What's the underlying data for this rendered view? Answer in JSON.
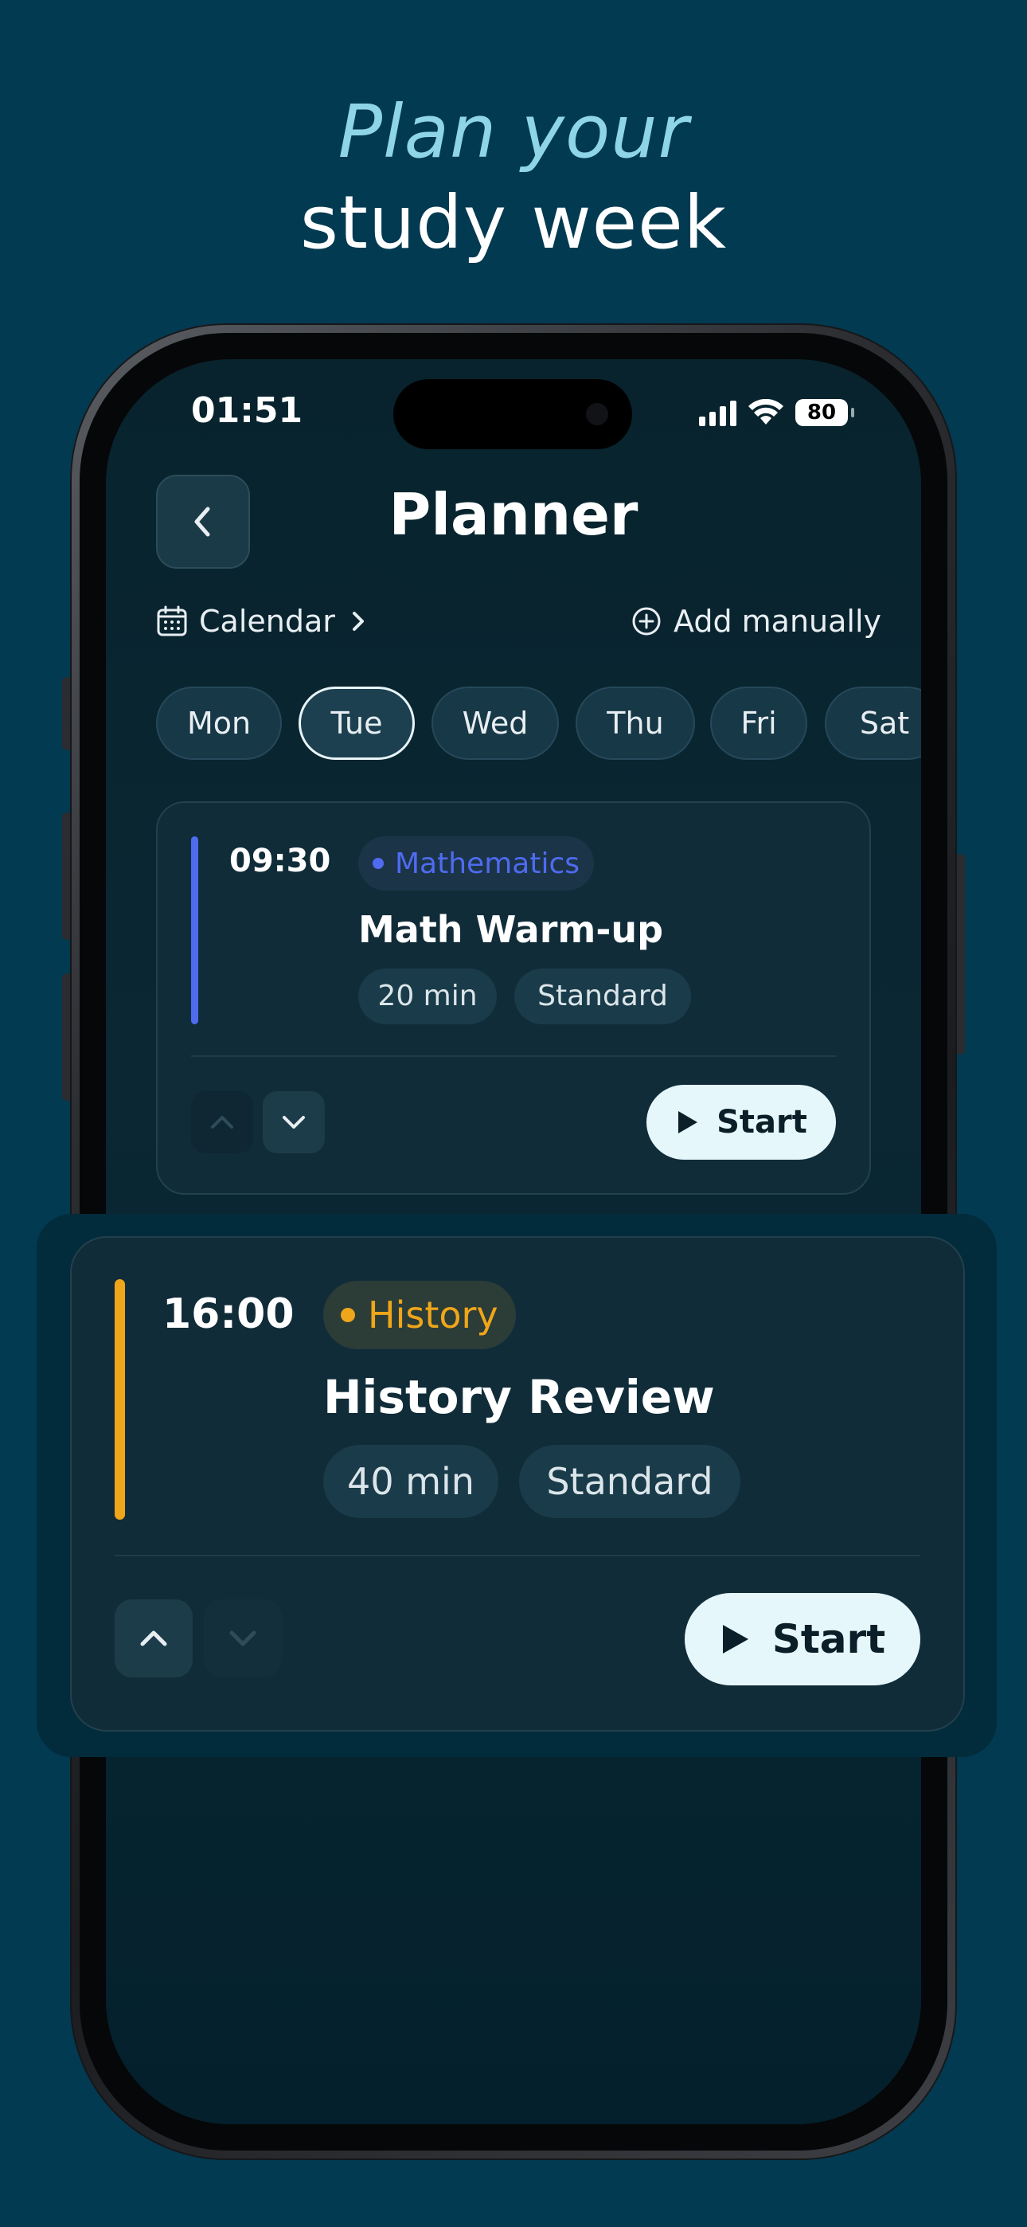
{
  "headline": {
    "line1": "Plan your",
    "line2": "study week"
  },
  "status_bar": {
    "time": "01:51",
    "battery": "80"
  },
  "header": {
    "title": "Planner"
  },
  "links": {
    "calendar": "Calendar",
    "add_manually": "Add manually"
  },
  "days": [
    {
      "label": "Mon",
      "selected": false
    },
    {
      "label": "Tue",
      "selected": true
    },
    {
      "label": "Wed",
      "selected": false
    },
    {
      "label": "Thu",
      "selected": false
    },
    {
      "label": "Fri",
      "selected": false
    },
    {
      "label": "Sat",
      "selected": false
    }
  ],
  "tasks": [
    {
      "time": "09:30",
      "subject": "Mathematics",
      "subject_color": "#4f6bf0",
      "title": "Math Warm-up",
      "duration": "20 min",
      "mode": "Standard",
      "start_label": "Start",
      "can_move_up": false,
      "can_move_down": true
    },
    {
      "time": "16:00",
      "subject": "History",
      "subject_color": "#f0a61a",
      "title": "History Review",
      "duration": "40 min",
      "mode": "Standard",
      "start_label": "Start",
      "can_move_up": true,
      "can_move_down": false
    }
  ],
  "colors": {
    "background": "#023a51",
    "accent_headline": "#8fd5e8",
    "start_button": "#e6f7fc"
  }
}
